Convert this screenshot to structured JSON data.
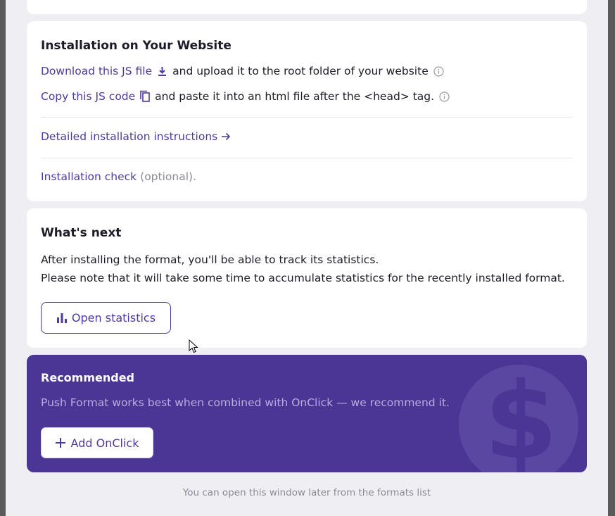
{
  "installation": {
    "title": "Installation on Your Website",
    "download_link": "Download this JS file",
    "download_text": "and upload it to the root folder of your website",
    "copy_link": "Copy this JS code",
    "copy_text": "and paste it into an html file after the <head> tag.",
    "instructions_link": "Detailed installation instructions",
    "check_link": "Installation check",
    "check_suffix": "(optional)."
  },
  "whats_next": {
    "title": "What's next",
    "line1": "After installing the format, you'll be able to track its statistics.",
    "line2": "Please note that it will take some time to accumulate statistics for the recently installed format.",
    "button_label": "Open statistics"
  },
  "recommended": {
    "title": "Recommended",
    "text": "Push Format works best when combined with OnClick — we recommend it.",
    "button_label": "Add OnClick"
  },
  "footer": {
    "text": "You can open this window later from the formats list"
  },
  "colors": {
    "accent": "#4d3a9e",
    "recommended_bg": "#4b3696",
    "modal_bg": "#eeeef3"
  },
  "icons": [
    "download-icon",
    "copy-icon",
    "info-icon",
    "arrow-right-icon",
    "bar-chart-icon",
    "plus-icon",
    "dollar-coin-icon",
    "mouse-cursor-icon"
  ]
}
